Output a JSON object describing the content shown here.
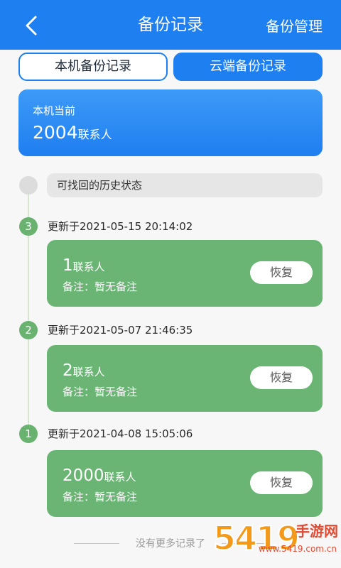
{
  "header": {
    "title": "备份记录",
    "action_label": "备份管理",
    "back_icon": "chevron-left-icon"
  },
  "tabs": [
    {
      "label": "本机备份记录",
      "active": false
    },
    {
      "label": "云端备份记录",
      "active": true
    }
  ],
  "summary": {
    "label": "本机当前",
    "count": "2004",
    "unit": "联系人"
  },
  "history_label": "可找回的历史状态",
  "records": [
    {
      "step": "3",
      "time": "更新于2021-05-15 20:14:02",
      "count": "1",
      "unit": "联系人",
      "note": "备注：暂无备注",
      "restore_label": "恢复"
    },
    {
      "step": "2",
      "time": "更新于2021-05-07 21:46:35",
      "count": "2",
      "unit": "联系人",
      "note": "备注：暂无备注",
      "restore_label": "恢复"
    },
    {
      "step": "1",
      "time": "更新于2021-04-08 15:05:06",
      "count": "2000",
      "unit": "联系人",
      "note": "备注：暂无备注",
      "restore_label": "恢复"
    }
  ],
  "footer_text": "没有更多记录了",
  "watermark": {
    "digits": "5419",
    "text": "手游网",
    "domain": "www.5419.com.cn"
  },
  "colors": {
    "primary": "#1e7ff0",
    "card_green": "#6ab574",
    "step_green": "#69b270",
    "background": "#f7f7f7"
  }
}
